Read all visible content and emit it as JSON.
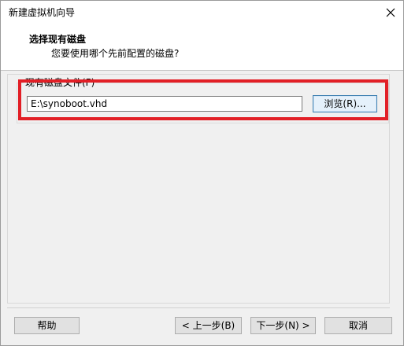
{
  "window": {
    "title": "新建虚拟机向导"
  },
  "header": {
    "title": "选择现有磁盘",
    "subtitle": "您要使用哪个先前配置的磁盘?"
  },
  "disk": {
    "group_label": "现有磁盘文件(F)",
    "path_value": "E:\\synoboot.vhd",
    "browse_label": "浏览(R)..."
  },
  "footer": {
    "help_label": "帮助",
    "back_label": "< 上一步(B)",
    "next_label": "下一步(N) >",
    "cancel_label": "取消"
  },
  "colors": {
    "highlight": "#e21f26",
    "primary_button_border": "#3c7fb1",
    "body_background": "#f0f0f0"
  }
}
